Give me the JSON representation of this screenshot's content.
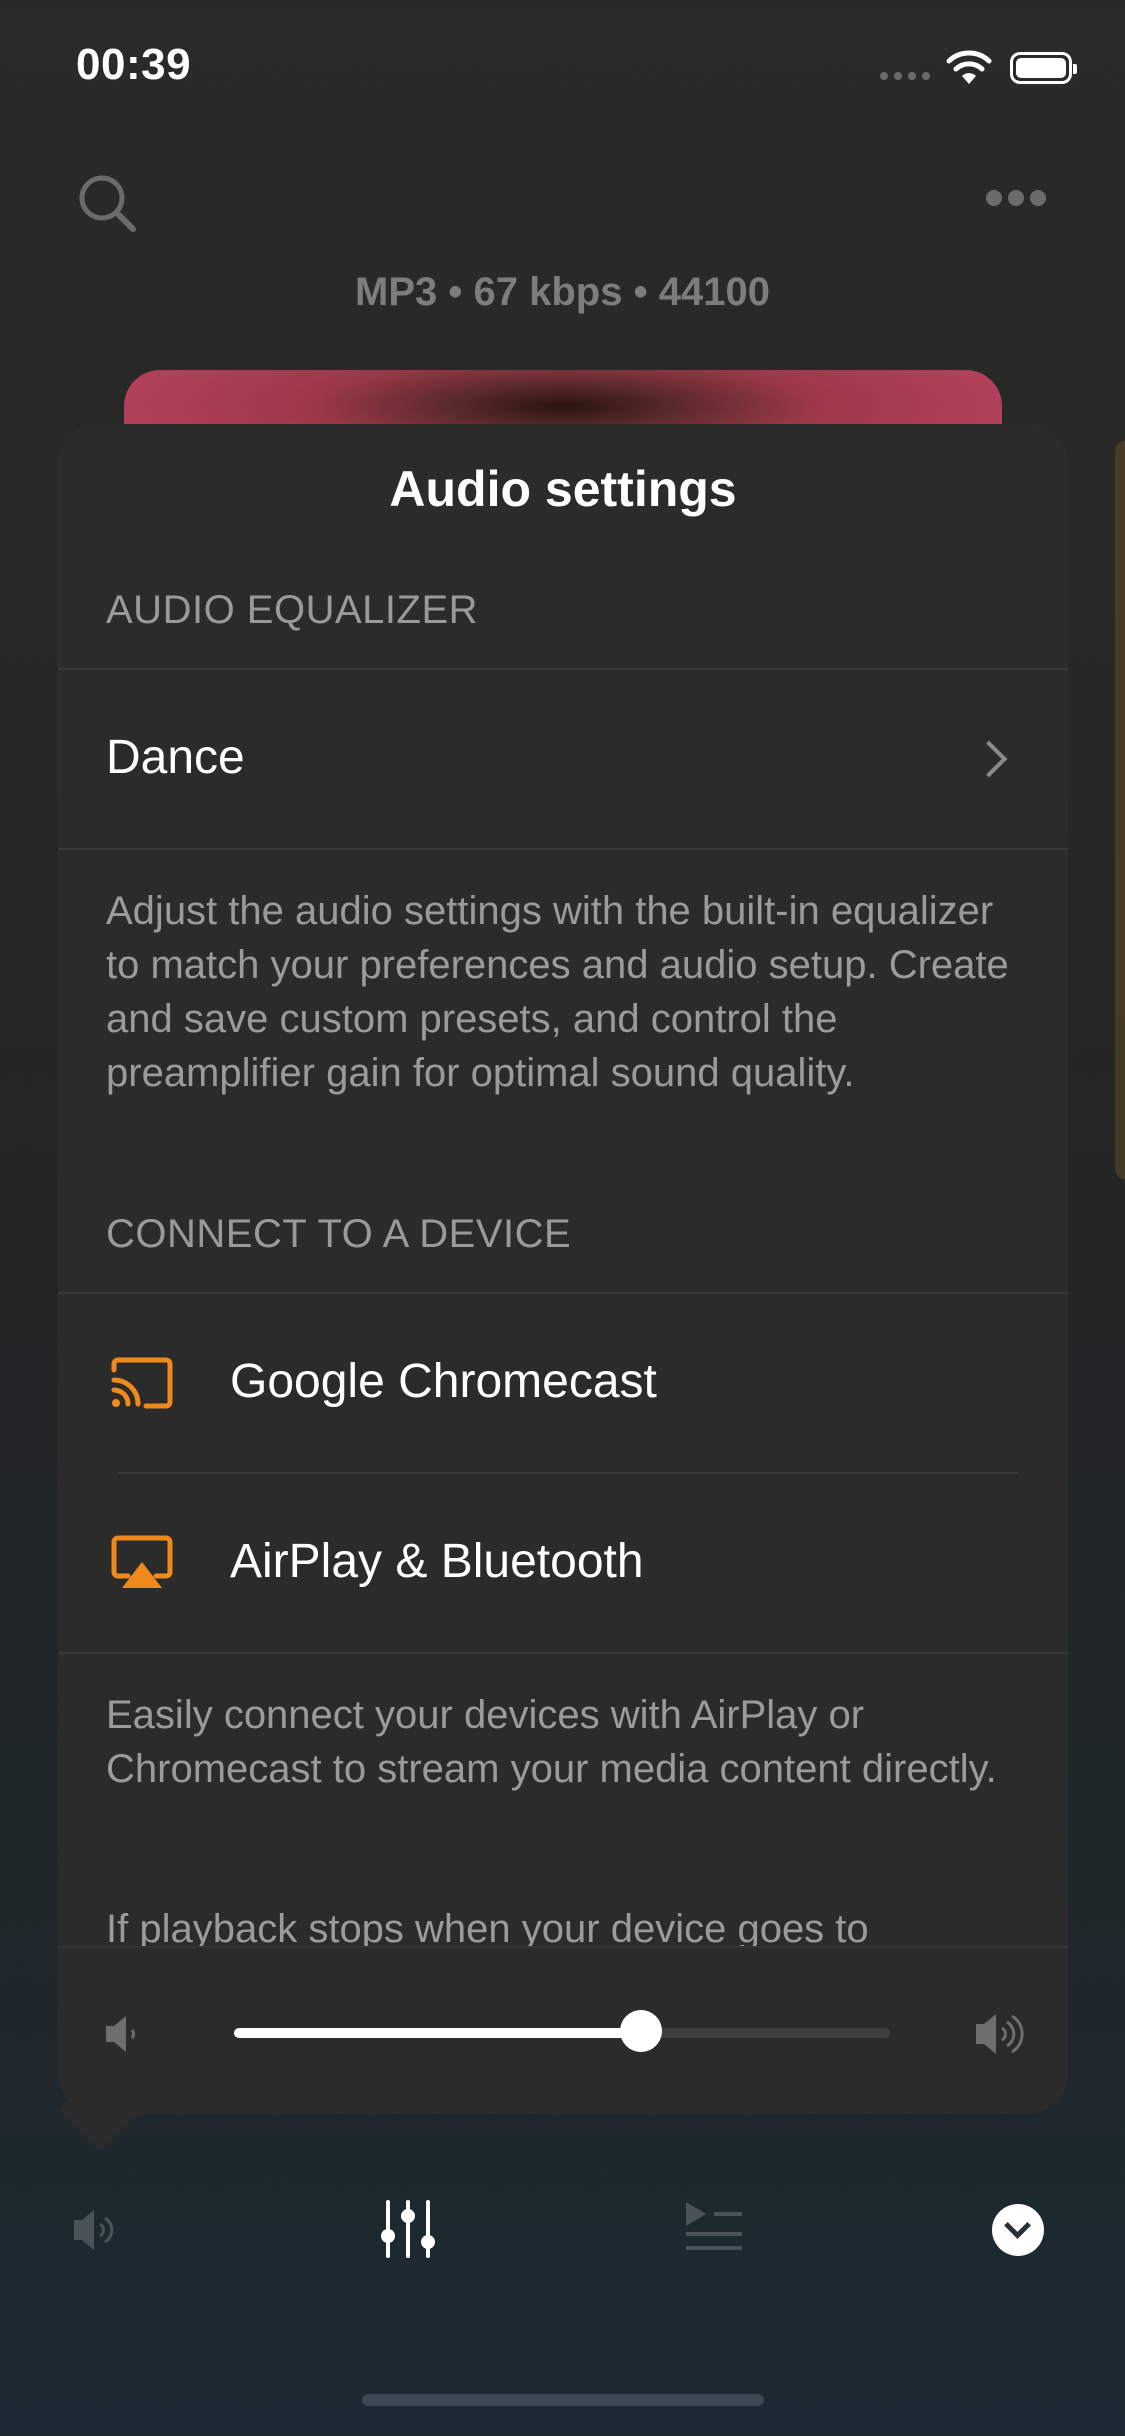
{
  "status_bar": {
    "time": "00:39"
  },
  "player": {
    "format_info": "MP3 • 67 kbps • 44100"
  },
  "audio_settings": {
    "title": "Audio settings",
    "equalizer_header": "AUDIO EQUALIZER",
    "equalizer_preset": "Dance",
    "equalizer_description": "Adjust the audio settings with the built-in equalizer to match your preferences and audio setup. Create and save custom presets, and control the preamplifier gain for optimal sound quality.",
    "connect_header": "CONNECT TO A DEVICE",
    "devices": [
      {
        "label": "Google Chromecast",
        "icon": "cast-icon"
      },
      {
        "label": "AirPlay & Bluetooth",
        "icon": "airplay-icon"
      }
    ],
    "connect_description": "Easily connect your devices with AirPlay or Chromecast to stream your media content directly.",
    "connect_description_2": "If playback stops when your device goes to",
    "volume_level": 0.62
  },
  "toolbar": {
    "items": [
      "speaker-icon",
      "equalizer-icon",
      "queue-icon",
      "collapse-icon"
    ]
  },
  "colors": {
    "accent": "#f08a1c",
    "panel": "#2b2b2c",
    "secondary_text": "#9b9b9b"
  }
}
